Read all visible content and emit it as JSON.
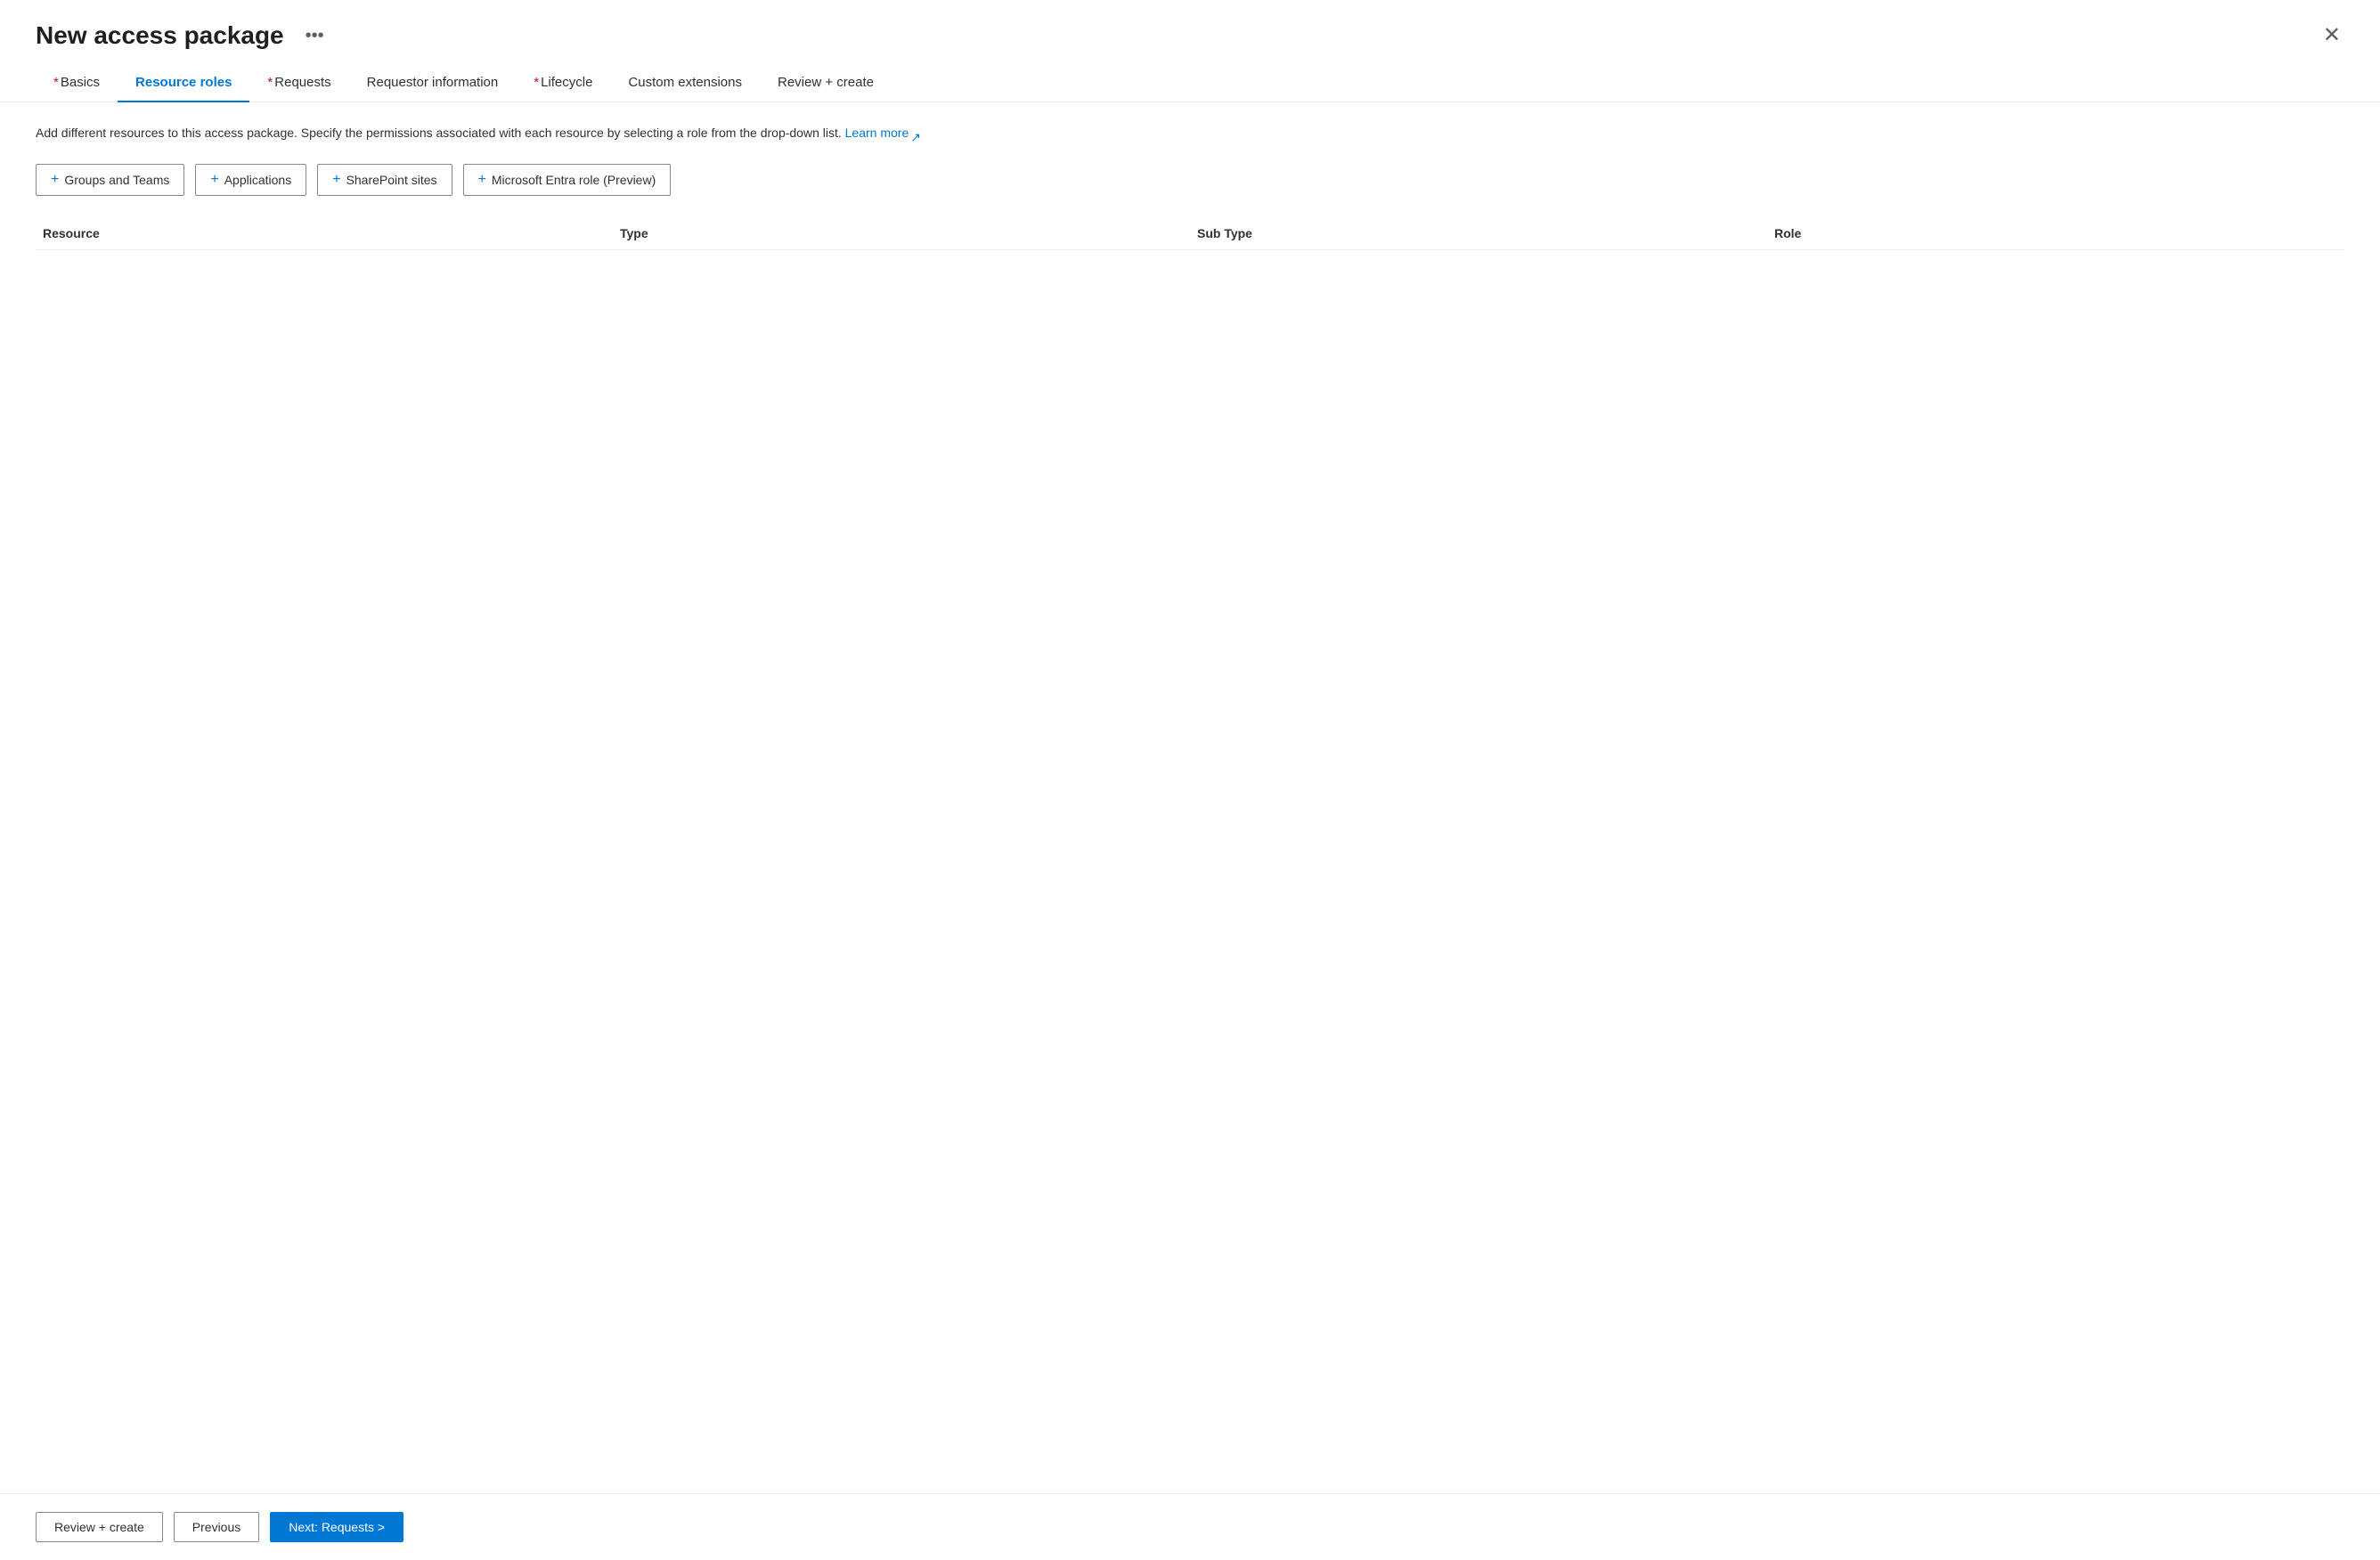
{
  "header": {
    "title": "New access package",
    "more_options_icon": "•••",
    "close_icon": "✕"
  },
  "tabs": [
    {
      "id": "basics",
      "label": "Basics",
      "required": true,
      "active": false
    },
    {
      "id": "resource-roles",
      "label": "Resource roles",
      "required": false,
      "active": true
    },
    {
      "id": "requests",
      "label": "Requests",
      "required": true,
      "active": false
    },
    {
      "id": "requestor-information",
      "label": "Requestor information",
      "required": false,
      "active": false
    },
    {
      "id": "lifecycle",
      "label": "Lifecycle",
      "required": true,
      "active": false
    },
    {
      "id": "custom-extensions",
      "label": "Custom extensions",
      "required": false,
      "active": false
    },
    {
      "id": "review-create",
      "label": "Review + create",
      "required": false,
      "active": false
    }
  ],
  "description": {
    "text": "Add different resources to this access package. Specify the permissions associated with each resource by selecting a role from the drop-down list.",
    "learn_more_label": "Learn more",
    "external_link_symbol": "↗"
  },
  "action_buttons": [
    {
      "id": "groups-teams",
      "label": "Groups and Teams",
      "plus": "+"
    },
    {
      "id": "applications",
      "label": "Applications",
      "plus": "+"
    },
    {
      "id": "sharepoint-sites",
      "label": "SharePoint sites",
      "plus": "+"
    },
    {
      "id": "microsoft-entra-role",
      "label": "Microsoft Entra role (Preview)",
      "plus": "+"
    }
  ],
  "table": {
    "columns": [
      {
        "id": "resource",
        "label": "Resource"
      },
      {
        "id": "type",
        "label": "Type"
      },
      {
        "id": "sub-type",
        "label": "Sub Type"
      },
      {
        "id": "role",
        "label": "Role"
      }
    ],
    "rows": []
  },
  "footer": {
    "review_create_label": "Review + create",
    "previous_label": "Previous",
    "next_label": "Next: Requests >"
  }
}
